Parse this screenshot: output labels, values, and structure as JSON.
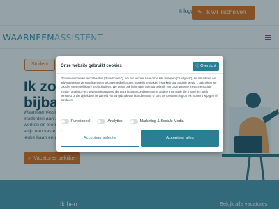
{
  "header": {
    "login_label": "Inloggen",
    "signup_label": "Ik wil inschrijven",
    "signup_icon": "pencil-icon"
  },
  "nav": {
    "logo_bold": "WAARNEEM",
    "logo_light": "ASSISTENT",
    "menu_icon": "hamburger-menu-icon"
  },
  "hero": {
    "tab_label": "Student",
    "title_line1": "Ik zoek",
    "title_line2": "bijbaan",
    "text_lines": [
      "WaarneemAssist",
      "studenten aan stu",
      "werken en leerde",
      "altijd een vaste w",
      "leuke baan en de"
    ],
    "cta_label": "Vacatures bekijken",
    "cta_icon": "search-icon"
  },
  "band": {
    "left_label": "Ik ben...",
    "right_label": "Bekijk alle vacatures"
  },
  "cookie_modal": {
    "title": "Onze website gebruikt cookies",
    "overview_label": "Overzicht",
    "overview_icon": "info-icon",
    "body": "Om uw voorkeuren te onthouden (\"Functioneel\"), om het verkeer naar onze site te meten (\"Analytics\"), en om inhoud en advertenties te personaliseren en sociale media-functies mogelijk te maken (\"Marketing & Sociale Media\"), gebruiken we cookies en vergelijkbare technologieën. We delen ook informatie over uw gebruik van onze website met onze sociale media-, analytics- en advertentiepartners, die deze kunnen combineren met andere informatie die u aan hen heeft verstrekt of die zij hebben verzameld via uw gebruik van hun diensten. U kunt uw toestemming op elk moment wijzigen of intrekken.",
    "toggles": [
      {
        "label": "Functioneel",
        "on": false
      },
      {
        "label": "Analytics",
        "on": false
      },
      {
        "label": "Marketing & Sociale Media",
        "on": false
      }
    ],
    "accept_selection_label": "Accepteer selectie",
    "accept_all_label": "Accepteer alles"
  },
  "colors": {
    "accent_orange": "#e46a12",
    "brand_teal": "#2a7f95",
    "band_blue": "#4d97ad"
  }
}
